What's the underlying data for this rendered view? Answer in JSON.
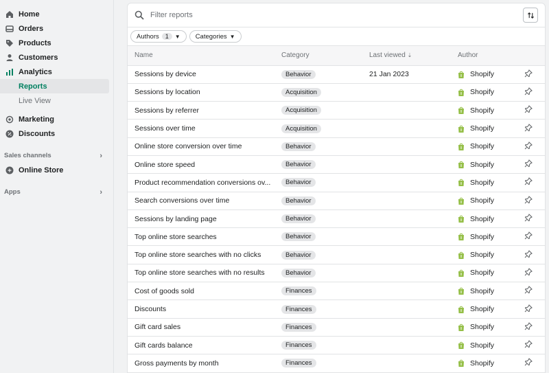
{
  "sidebar": {
    "nav": [
      {
        "label": "Home",
        "icon": "home-icon"
      },
      {
        "label": "Orders",
        "icon": "orders-icon"
      },
      {
        "label": "Products",
        "icon": "tag-icon"
      },
      {
        "label": "Customers",
        "icon": "person-icon"
      },
      {
        "label": "Analytics",
        "icon": "bar-chart-icon"
      }
    ],
    "analytics_sub": [
      {
        "label": "Reports",
        "active": true
      },
      {
        "label": "Live View",
        "active": false
      }
    ],
    "nav2": [
      {
        "label": "Marketing",
        "icon": "target-icon"
      },
      {
        "label": "Discounts",
        "icon": "discount-icon"
      }
    ],
    "sales_channels_label": "Sales channels",
    "online_store_label": "Online Store",
    "apps_label": "Apps"
  },
  "search": {
    "placeholder": "Filter reports"
  },
  "filters": {
    "authors_label": "Authors",
    "authors_count": "1",
    "categories_label": "Categories"
  },
  "table": {
    "headers": {
      "name": "Name",
      "category": "Category",
      "last_viewed": "Last viewed",
      "author": "Author"
    },
    "rows": [
      {
        "name": "Sessions by device",
        "category": "Behavior",
        "last_viewed": "21 Jan 2023",
        "author": "Shopify"
      },
      {
        "name": "Sessions by location",
        "category": "Acquisition",
        "last_viewed": "",
        "author": "Shopify"
      },
      {
        "name": "Sessions by referrer",
        "category": "Acquisition",
        "last_viewed": "",
        "author": "Shopify"
      },
      {
        "name": "Sessions over time",
        "category": "Acquisition",
        "last_viewed": "",
        "author": "Shopify"
      },
      {
        "name": "Online store conversion over time",
        "category": "Behavior",
        "last_viewed": "",
        "author": "Shopify"
      },
      {
        "name": "Online store speed",
        "category": "Behavior",
        "last_viewed": "",
        "author": "Shopify"
      },
      {
        "name": "Product recommendation conversions ov...",
        "category": "Behavior",
        "last_viewed": "",
        "author": "Shopify"
      },
      {
        "name": "Search conversions over time",
        "category": "Behavior",
        "last_viewed": "",
        "author": "Shopify"
      },
      {
        "name": "Sessions by landing page",
        "category": "Behavior",
        "last_viewed": "",
        "author": "Shopify"
      },
      {
        "name": "Top online store searches",
        "category": "Behavior",
        "last_viewed": "",
        "author": "Shopify"
      },
      {
        "name": "Top online store searches with no clicks",
        "category": "Behavior",
        "last_viewed": "",
        "author": "Shopify"
      },
      {
        "name": "Top online store searches with no results",
        "category": "Behavior",
        "last_viewed": "",
        "author": "Shopify"
      },
      {
        "name": "Cost of goods sold",
        "category": "Finances",
        "last_viewed": "",
        "author": "Shopify"
      },
      {
        "name": "Discounts",
        "category": "Finances",
        "last_viewed": "",
        "author": "Shopify"
      },
      {
        "name": "Gift card sales",
        "category": "Finances",
        "last_viewed": "",
        "author": "Shopify"
      },
      {
        "name": "Gift cards balance",
        "category": "Finances",
        "last_viewed": "",
        "author": "Shopify"
      },
      {
        "name": "Gross payments by month",
        "category": "Finances",
        "last_viewed": "",
        "author": "Shopify"
      }
    ]
  },
  "colors": {
    "accent": "#008060",
    "shopify_green": "#95bf47"
  }
}
